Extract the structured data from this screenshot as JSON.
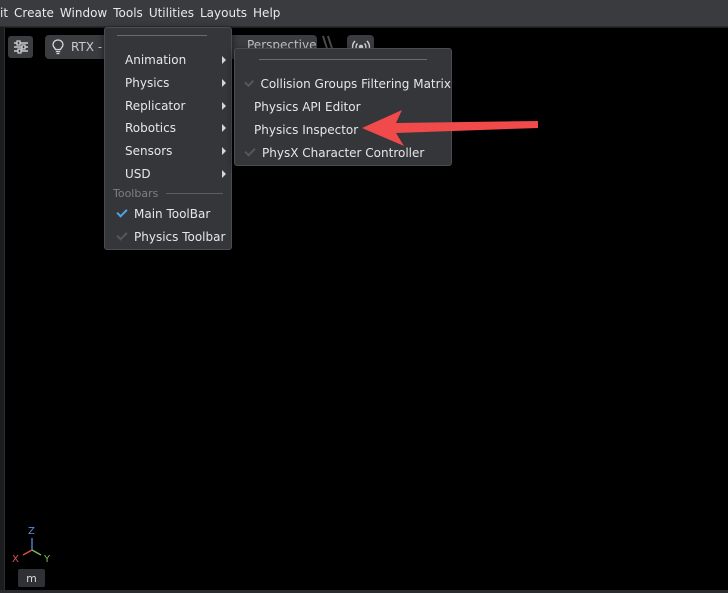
{
  "menubar": {
    "items": [
      "it",
      "Create",
      "Window",
      "Tools",
      "Utilities",
      "Layouts",
      "Help"
    ]
  },
  "viewport": {
    "renderer_label": "RTX -",
    "camera_label": "Perspective"
  },
  "tools_menu": {
    "items": [
      {
        "label": "Animation",
        "submenu": true
      },
      {
        "label": "Physics",
        "submenu": true
      },
      {
        "label": "Replicator",
        "submenu": true
      },
      {
        "label": "Robotics",
        "submenu": true
      },
      {
        "label": "Sensors",
        "submenu": true
      },
      {
        "label": "USD",
        "submenu": true
      }
    ],
    "section_label": "Toolbars",
    "toolbar_items": [
      {
        "label": "Main ToolBar",
        "checked": true
      },
      {
        "label": "Physics Toolbar",
        "checked": false
      }
    ]
  },
  "physics_menu": {
    "items": [
      {
        "label": "Collision Groups Filtering Matrix",
        "checked": false
      },
      {
        "label": "Physics API Editor"
      },
      {
        "label": "Physics Inspector"
      },
      {
        "label": "PhysX Character Controller",
        "checked": false
      }
    ]
  },
  "gizmo": {
    "z": "Z",
    "x": "X",
    "y": "Y",
    "mode_button": "m"
  },
  "colors": {
    "menubar": "#3a3b3e",
    "menu_bg": "#34363a",
    "check_on": "#4fa3e0",
    "annotation_arrow": "#f04a4a",
    "axis_x": "#d9534f",
    "axis_y": "#7ac15a",
    "axis_z": "#5b8fd6"
  }
}
